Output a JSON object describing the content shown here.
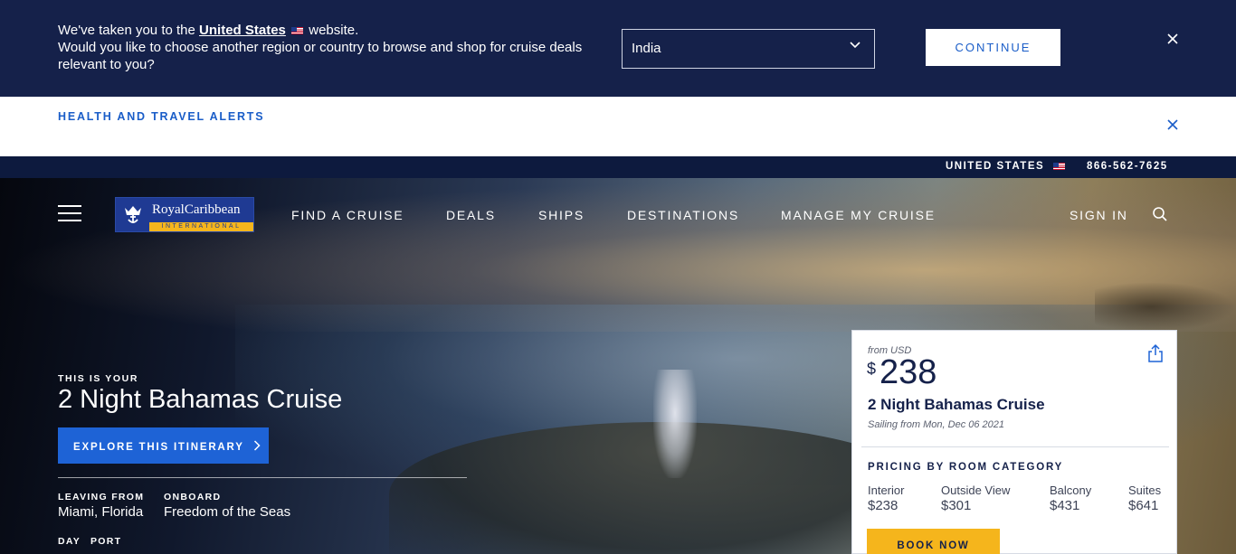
{
  "region_banner": {
    "line1_prefix": "We've taken you to the",
    "line1_link": "United States",
    "line1_suffix": "website.",
    "line2": "Would you like to choose another region or country to browse and shop for cruise deals relevant to you?",
    "select_value": "India",
    "continue_label": "CONTINUE"
  },
  "alerts": {
    "title": "HEALTH AND TRAVEL ALERTS"
  },
  "utility": {
    "country": "UNITED STATES",
    "phone": "866-562-7625"
  },
  "logo": {
    "name": "RoyalCaribbean",
    "tagline": "INTERNATIONAL"
  },
  "nav": {
    "items": [
      "FIND A CRUISE",
      "DEALS",
      "SHIPS",
      "DESTINATIONS",
      "MANAGE MY CRUISE"
    ],
    "sign_in": "SIGN IN"
  },
  "hero": {
    "eyebrow": "THIS IS YOUR",
    "title": "2 Night Bahamas Cruise",
    "cta": "EXPLORE THIS ITINERARY",
    "leaving_label": "LEAVING FROM",
    "leaving_value": "Miami, Florida",
    "onboard_label": "ONBOARD",
    "onboard_value": "Freedom of the Seas",
    "day_label": "DAY",
    "port_label": "PORT"
  },
  "price_card": {
    "from_label": "from USD",
    "currency": "$",
    "amount": "238",
    "title": "2 Night Bahamas Cruise",
    "sailing": "Sailing from Mon, Dec 06 2021",
    "section_title": "PRICING BY ROOM CATEGORY",
    "categories": [
      {
        "name": "Interior",
        "price": "$238"
      },
      {
        "name": "Outside View",
        "price": "$301"
      },
      {
        "name": "Balcony",
        "price": "$431"
      },
      {
        "name": "Suites",
        "price": "$641"
      }
    ],
    "book_label": "BOOK NOW"
  },
  "colors": {
    "navy": "#15214a",
    "accent_blue": "#1e63d6",
    "gold": "#f5b51c"
  }
}
